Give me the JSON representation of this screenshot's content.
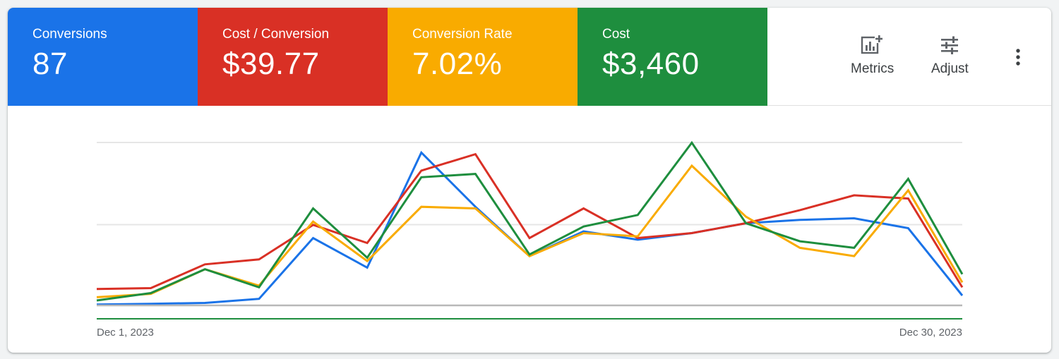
{
  "scorecards": [
    {
      "label": "Conversions",
      "value": "87",
      "color": "#1a73e8"
    },
    {
      "label": "Cost / Conversion",
      "value": "$39.77",
      "color": "#d93025"
    },
    {
      "label": "Conversion Rate",
      "value": "7.02%",
      "color": "#f9ab00"
    },
    {
      "label": "Cost",
      "value": "$3,460",
      "color": "#1e8e3e"
    }
  ],
  "toolbar": {
    "metrics_label": "Metrics",
    "adjust_label": "Adjust",
    "metrics_icon": "add-chart-icon",
    "adjust_icon": "tune-icon",
    "more_icon": "more-vert-icon"
  },
  "chart_data": {
    "type": "line",
    "x": [
      1,
      2,
      3,
      4,
      5,
      6,
      7,
      8,
      9,
      10,
      11,
      12,
      13,
      14,
      15,
      16,
      17,
      18
    ],
    "x_start_label": "Dec 1, 2023",
    "x_end_label": "Dec 30, 2023",
    "ylim": [
      0,
      100
    ],
    "grid": true,
    "series": [
      {
        "color": "#1a73e8",
        "values": [
          0.5,
          1,
          1.5,
          4,
          41,
          23,
          93,
          60,
          30,
          45,
          40,
          44,
          50,
          52,
          53,
          47,
          6
        ]
      },
      {
        "color": "#d93025",
        "values": [
          10,
          10.5,
          25,
          28,
          49,
          38,
          82,
          92,
          41,
          59,
          41,
          44,
          50,
          58,
          67,
          65,
          11
        ]
      },
      {
        "color": "#f9ab00",
        "values": [
          5,
          7,
          22,
          12,
          51,
          27,
          60,
          59,
          30,
          44,
          42,
          85,
          54,
          35,
          30,
          70,
          14
        ]
      },
      {
        "color": "#1e8e3e",
        "values": [
          3,
          7.5,
          22,
          11,
          59,
          29,
          78,
          80,
          31,
          48,
          55,
          99,
          50,
          39,
          35,
          77,
          19
        ]
      }
    ]
  }
}
